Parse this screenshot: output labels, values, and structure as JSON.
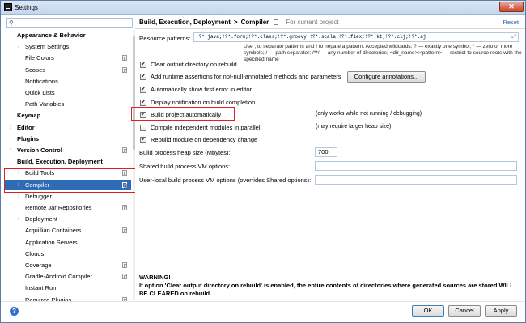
{
  "window": {
    "title": "Settings"
  },
  "search": {
    "value": ""
  },
  "sidebar": {
    "items": [
      {
        "label": "Appearance & Behavior",
        "level": 0,
        "bold": true,
        "expanded": true
      },
      {
        "label": "System Settings",
        "level": 1,
        "chevron": true
      },
      {
        "label": "File Colors",
        "level": 1,
        "copy": true
      },
      {
        "label": "Scopes",
        "level": 1,
        "copy": true
      },
      {
        "label": "Notifications",
        "level": 1
      },
      {
        "label": "Quick Lists",
        "level": 1
      },
      {
        "label": "Path Variables",
        "level": 1
      },
      {
        "label": "Keymap",
        "level": 0,
        "bold": true
      },
      {
        "label": "Editor",
        "level": 0,
        "bold": true,
        "chevron": true
      },
      {
        "label": "Plugins",
        "level": 0,
        "bold": true
      },
      {
        "label": "Version Control",
        "level": 0,
        "bold": true,
        "chevron": true,
        "copy": true
      },
      {
        "label": "Build, Execution, Deployment",
        "level": 0,
        "bold": true,
        "expanded": true
      },
      {
        "label": "Build Tools",
        "level": 1,
        "chevron": true,
        "copy": true
      },
      {
        "label": "Compiler",
        "level": 1,
        "chevron": true,
        "copy": true,
        "selected": true
      },
      {
        "label": "Debugger",
        "level": 1,
        "chevron": true
      },
      {
        "label": "Remote Jar Repositories",
        "level": 1,
        "copy": true
      },
      {
        "label": "Deployment",
        "level": 1,
        "chevron": true
      },
      {
        "label": "Arquillian Containers",
        "level": 1,
        "copy": true
      },
      {
        "label": "Application Servers",
        "level": 1
      },
      {
        "label": "Clouds",
        "level": 1
      },
      {
        "label": "Coverage",
        "level": 1,
        "copy": true
      },
      {
        "label": "Gradle-Android Compiler",
        "level": 1,
        "copy": true
      },
      {
        "label": "Instant Run",
        "level": 1
      },
      {
        "label": "Required Plugins",
        "level": 1,
        "copy": true
      }
    ]
  },
  "breadcrumb": {
    "section": "Build, Execution, Deployment",
    "separator": ">",
    "page": "Compiler",
    "scope": "For current project"
  },
  "reset_label": "Reset",
  "resource_patterns": {
    "label": "Resource patterns:",
    "value": "!?*.java;!?*.form;!?*.class;!?*.groovy;!?*.scala;!?*.flex;!?*.kt;!?*.clj;!?*.aj",
    "hint": "Use ; to separate patterns and ! to negate a pattern. Accepted wildcards: ? — exactly one symbol; * — zero or more symbols; / — path separator; /**/ — any number of directories; <dir_name>:<pattern> — restrict to source roots with the specified name"
  },
  "options": [
    {
      "label": "Clear output directory on rebuild",
      "checked": true,
      "note": ""
    },
    {
      "label": "Add runtime assertions for not-null-annotated methods and parameters",
      "checked": true,
      "note": ""
    },
    {
      "label": "Automatically show first error in editor",
      "checked": true,
      "note": ""
    },
    {
      "label": "Display notification on build completion",
      "checked": true,
      "note": ""
    },
    {
      "label": "Build project automatically",
      "checked": true,
      "note": "(only works while not running / debugging)"
    },
    {
      "label": "Compile independent modules in parallel",
      "checked": false,
      "note": "(may require larger heap size)"
    },
    {
      "label": "Rebuild module on dependency change",
      "checked": true,
      "note": ""
    }
  ],
  "configure_annotations_label": "Configure annotations...",
  "heap_size": {
    "label": "Build process heap size (Mbytes):",
    "value": "700"
  },
  "shared_vm": {
    "label": "Shared build process VM options:",
    "value": ""
  },
  "user_vm": {
    "label": "User-local build process VM options (overrides Shared options):",
    "value": ""
  },
  "warning": {
    "title": "WARNING!",
    "text": "If option 'Clear output directory on rebuild' is enabled, the entire contents of directories where generated sources are stored WILL BE CLEARED on rebuild."
  },
  "buttons": {
    "ok": "OK",
    "cancel": "Cancel",
    "apply": "Apply"
  },
  "colors": {
    "selection": "#2e6db6",
    "highlight_box": "#e02020",
    "link": "#2b5fb4"
  }
}
